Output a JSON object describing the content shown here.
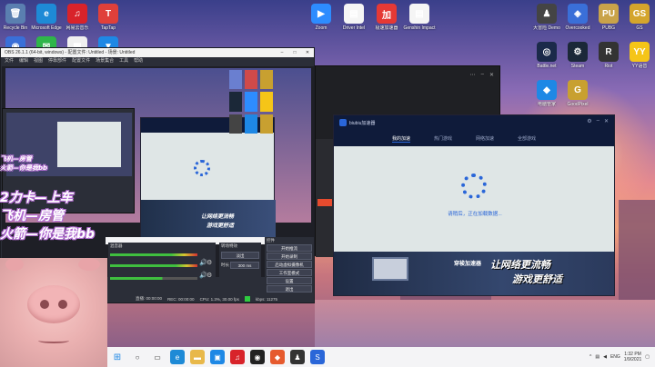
{
  "desktop": {
    "icons_left": [
      {
        "label": "Recycle Bin",
        "color": "#5a7fb0",
        "glyph": "🗑"
      },
      {
        "label": "Microsoft Edge",
        "color": "#1e8ad6",
        "glyph": "e"
      },
      {
        "label": "网易云音乐",
        "color": "#d8232a",
        "glyph": "♫"
      },
      {
        "label": "TapTap",
        "color": "#e0403a",
        "glyph": "T"
      }
    ],
    "icons_left2": [
      {
        "label": "",
        "color": "#3a6fd8",
        "glyph": "◉"
      },
      {
        "label": "",
        "color": "#2fb54a",
        "glyph": "✉"
      },
      {
        "label": "",
        "color": "#f0f0f0",
        "glyph": "▦"
      },
      {
        "label": "",
        "color": "#1e88e5",
        "glyph": "▼"
      }
    ],
    "icons_top": [
      {
        "label": "Zoom",
        "color": "#2d8cff",
        "glyph": "▶"
      },
      {
        "label": "Driver Intel",
        "color": "#f5f5f5",
        "glyph": "▤"
      },
      {
        "label": "极速加速器",
        "color": "#e53935",
        "glyph": "加"
      },
      {
        "label": "Genshin Impact",
        "color": "#f5f5f5",
        "glyph": "▤"
      }
    ],
    "icons_right": [
      {
        "label": "大冒险 Demo",
        "color": "#444",
        "glyph": "♟"
      },
      {
        "label": "Overcooked",
        "color": "#3a6fd8",
        "glyph": "◈"
      },
      {
        "label": "PUBG",
        "color": "#c9a34a",
        "glyph": "PU"
      },
      {
        "label": "GS",
        "color": "#d4a52c",
        "glyph": "GS"
      },
      {
        "label": "Battle.net",
        "color": "#1b2a4a",
        "glyph": "◎"
      },
      {
        "label": "Steam",
        "color": "#1b2838",
        "glyph": "⚙"
      },
      {
        "label": "Riot",
        "color": "#333",
        "glyph": "R"
      },
      {
        "label": "YY语音",
        "color": "#f5c518",
        "glyph": "YY"
      },
      {
        "label": "电脑管家",
        "color": "#1e88e5",
        "glyph": "◆"
      },
      {
        "label": "GoodPixel",
        "color": "#c8a030",
        "glyph": "G"
      }
    ]
  },
  "obs": {
    "title": "OBS 26.1.1 (64-bit, windows) - 配置文件: Untitled - 场景: Untitled",
    "menu": [
      "文件",
      "编辑",
      "视图",
      "停靠部件",
      "配置文件",
      "场景集合",
      "工具",
      "帮助"
    ],
    "mixer_title": "混音器",
    "transition_title": "转场特效",
    "transition_type": "淡出",
    "duration_label": "时长",
    "duration_value": "300 ms",
    "controls_title": "控件",
    "controls": [
      "开始推流",
      "开始录制",
      "启动虚拟摄像机",
      "工作室模式",
      "设置",
      "退出"
    ],
    "status": [
      "直播: 00:00:00",
      "REC: 00:00:00",
      "CPU: 1.3%, 30.00 fps",
      "kbps: 11275"
    ]
  },
  "overlay": {
    "line1": "2力卡—上车",
    "line2": "飞机—房管",
    "line3": "火箭—你是我bb",
    "small_line1": "飞机—房管",
    "small_line2": "火箭—你是我bb"
  },
  "acc_app": {
    "app_name": "biubiu加速器",
    "tabs": [
      "我的加速",
      "热门游戏",
      "网络加速",
      "全部游戏"
    ],
    "loading_text": "请稍后，正在加载数据...",
    "banner_line1": "让网络更流畅",
    "banner_line2": "游戏更舒适",
    "banner_small": "穿梭加速器"
  },
  "taskbar": {
    "time": "1:32 PM",
    "date": "1/9/2021",
    "lang": "ENG"
  }
}
